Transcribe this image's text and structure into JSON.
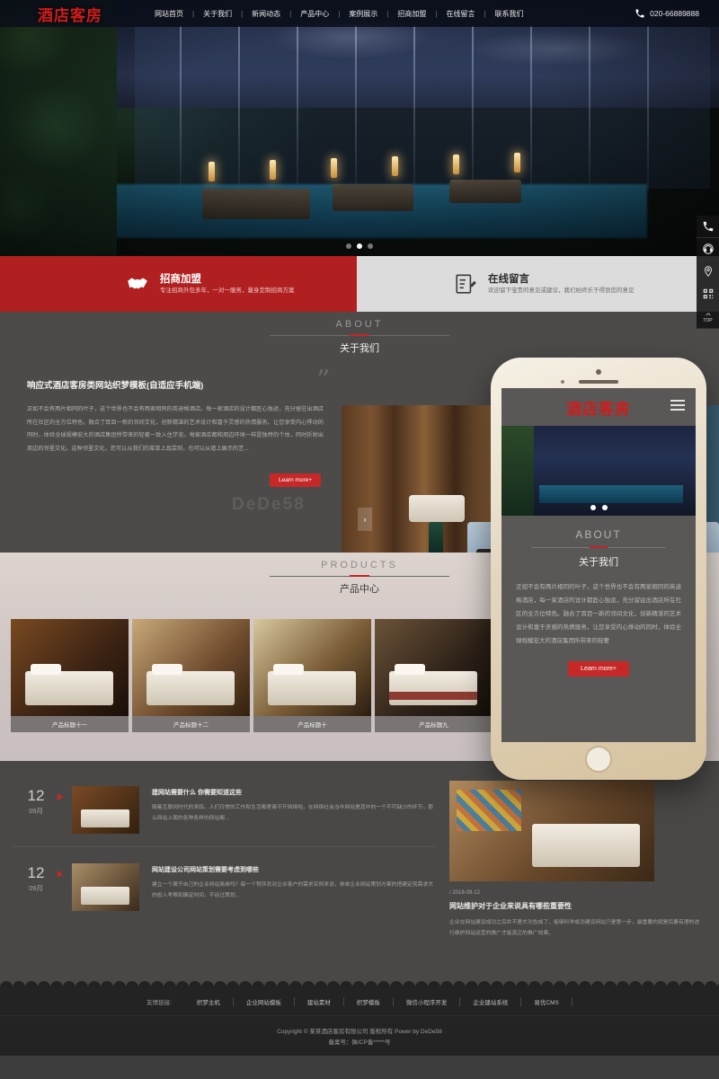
{
  "header": {
    "logo": "酒店客房",
    "nav": [
      "网站首页",
      "关于我们",
      "新闻动态",
      "产品中心",
      "案例展示",
      "招商加盟",
      "在线留言",
      "联系我们"
    ],
    "phone_icon": "telephone-icon",
    "phone": "020-66889888"
  },
  "hero": {
    "slide_dots": 3,
    "active_dot": 2
  },
  "sidetools": [
    {
      "name": "phone-icon",
      "label": "电话"
    },
    {
      "name": "headset-icon",
      "label": "客服"
    },
    {
      "name": "location-pin-icon",
      "label": "地址"
    },
    {
      "name": "qr-code-icon",
      "label": "二维码"
    },
    {
      "name": "back-to-top-icon",
      "label": "TOP"
    }
  ],
  "banners": [
    {
      "icon": "handshake-icon",
      "title": "招商加盟",
      "subtitle": "专注招商外包多年，一对一服务，量身定制招商方案",
      "bg": "#b02020"
    },
    {
      "icon": "note-pencil-icon",
      "title": "在线留言",
      "subtitle": "欢迎留下宝贵的意见或建议，我们始终乐于得到您的意见",
      "bg": "#dcdcdc"
    }
  ],
  "about": {
    "en": "ABOUT",
    "cn": "关于我们",
    "title": "响应式酒店客房类网站织梦模板(自适应手机端)",
    "text": "正如不会有两片相同的叶子，这个世界也不会有两家相同的英迪格酒店。每一家酒店的设计都匠心独运，充分留驻出酒店所在社区的全方位特色。融合了耳目一新的邻间文化，创新精湛的艺术设计和富于灵感的热情服务。让您享受内心悸动的同时，体验全球规模宏大的酒店集团所带来的轻奢一致入住学览。每家酒店都和周边环境一样是独特的个体，同时折射出周边的邻里文化。这种邻里文化，您可以从我们的菜单上品尝到，也可以从墙上展示的艺...",
    "button": "Learn more+",
    "watermark": "DeDe58",
    "quote_glyph": "”"
  },
  "products": {
    "en": "PRODUCTS",
    "cn": "产品中心",
    "items": [
      {
        "title": "产品标题十一"
      },
      {
        "title": "产品标题十二"
      },
      {
        "title": "产品标题十"
      },
      {
        "title": "产品标题九"
      }
    ]
  },
  "news": {
    "left": [
      {
        "day": "12",
        "month": "09月",
        "title": "建网站需要什么 你需要知道这些",
        "desc": "随着互联网时代的来临，人们日常的工作和生活都更离不开网络啦，在网络社会当中网站是其中的一个不可缺少的环节，那么网站上面的各种各样的网站都..."
      },
      {
        "day": "12",
        "month": "09月",
        "title": "网站建设公司网站策划需要考虑到哪些",
        "desc": "建立一个属于自己的企业网站简单吗？每一个程序员对企业客户的需求实例来说，单单企业网站策划方案的搭建定就需求大的投入考察和确定时间，不经过策划..."
      }
    ],
    "right": {
      "date": "/ 2018-09-12",
      "title": "网站维护对于企业来说具有哪些重要性",
      "desc": "企业在网站建设成功之后并不是大功告成了，能够科学成功建设网站只是第一步，最重要的就是后要有理的进行维护网站运营的推广才能真正的推广效果。"
    }
  },
  "phone_mockup": {
    "logo": "酒店客房",
    "menu_icon": "hamburger-menu-icon",
    "about_en": "ABOUT",
    "about_cn": "关于我们",
    "about_text": "正如不会有两片相同的叶子，这个世界也不会有两家相同的英迪格酒店，每一家酒店的设计都匠心独运，充分留驻出酒店所在社区的全方位特色。融合了耳目一新的邻间文化，创新精湛的艺术设计和富于灵感的热情服务，让您享受内心悸动的同时，体验全球规模宏大的酒店集团所带来的轻奢",
    "button": "Learn more+"
  },
  "footer": {
    "links_label": "友情链接:",
    "links": [
      "织梦主机",
      "企业网站模板",
      "建站素材",
      "织梦模板",
      "微信小程序开发",
      "企业建站系统",
      "易优CMS"
    ],
    "copyright": "Copyright © 某某酒店客房有限公司 版权所有 Power by DeDe58",
    "icp": "备案号：陕ICP备*****号"
  }
}
